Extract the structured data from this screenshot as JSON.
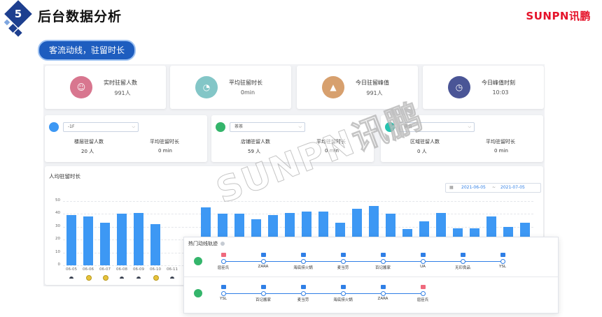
{
  "header": {
    "number": "5",
    "title": "后台数据分析",
    "brand": "SUNPN讯鹏",
    "subtitle": "客流动线，驻留时长"
  },
  "stats": [
    {
      "label": "实时驻留人数",
      "value": "991人",
      "icon": "people-icon",
      "color": "#d8768f"
    },
    {
      "label": "平均驻留时长",
      "value": "0min",
      "icon": "clock-icon",
      "color": "#83c6c7"
    },
    {
      "label": "今日驻留峰值",
      "value": "991人",
      "icon": "mountain-icon",
      "color": "#d7a06e"
    },
    {
      "label": "今日峰值时刻",
      "value": "10:03",
      "icon": "person-clock-icon",
      "color": "#4a5596"
    }
  ],
  "filters": [
    {
      "select": "-1F",
      "label1": "楼层驻留人数",
      "value1": "20 人",
      "label2": "平均驻留时长",
      "value2": "0 min",
      "icon": "layers-icon",
      "color": "#3d98f4"
    },
    {
      "select": "茶茶",
      "label1": "店铺驻留人数",
      "value1": "59 人",
      "label2": "平均驻留时长",
      "value2": "0 min",
      "icon": "shop-icon",
      "color": "#34b56b"
    },
    {
      "select": "美食",
      "label1": "区域驻留人数",
      "value1": "0 人",
      "label2": "平均驻留时长",
      "value2": "0 min",
      "icon": "area-icon",
      "color": "#26c3b0"
    }
  ],
  "chart_section": {
    "title": "人均驻留时长",
    "date_from": "2021-06-05",
    "date_sep": "~",
    "date_to": "2021-07-05"
  },
  "watermark": "SUNPN讯鹏",
  "chart_data": {
    "type": "bar",
    "title": "人均驻留时长",
    "ylim": [
      0,
      50
    ],
    "yticks": [
      "0",
      "10",
      "20",
      "30",
      "40",
      "50"
    ],
    "categories": [
      "06-05",
      "06-06",
      "06-07",
      "06-08",
      "06-09",
      "06-10",
      "06-11",
      "06-12",
      "",
      "",
      "",
      "",
      "",
      "",
      "",
      "",
      "",
      "",
      "",
      "",
      "",
      "",
      "",
      "",
      "",
      "",
      "",
      ""
    ],
    "values": [
      39,
      38,
      33,
      40,
      41,
      32,
      0,
      0,
      45,
      40,
      40,
      36,
      39,
      41,
      42,
      42,
      33,
      44,
      46,
      40,
      28,
      34,
      41,
      29,
      29,
      38,
      30,
      33
    ],
    "weather": [
      "cloud",
      "sun",
      "sun",
      "cloud",
      "cloud",
      "sun",
      "cloud",
      "cloud"
    ],
    "grid": true
  },
  "popup": {
    "title": "热门动线轨迹",
    "routes": [
      {
        "stops": [
          "屈臣氏",
          "ZARA",
          "海底捞火锅",
          "麦当劳",
          "百记酱家",
          "UA",
          "无印良品",
          "YSL"
        ]
      },
      {
        "stops": [
          "YSL",
          "百记酱家",
          "麦当劳",
          "海底捞火锅",
          "ZARA",
          "屈臣氏"
        ]
      }
    ]
  }
}
